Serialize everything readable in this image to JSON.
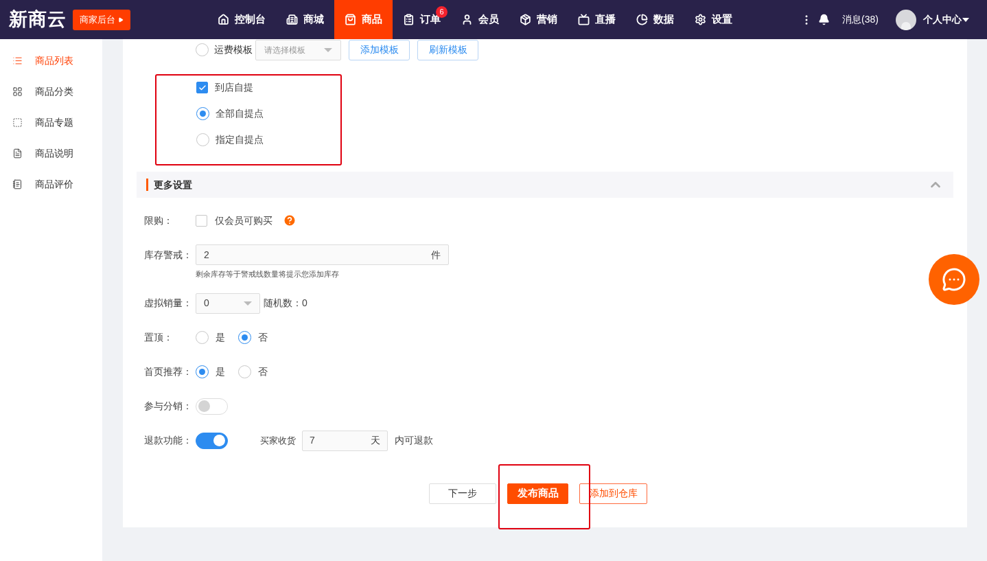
{
  "header": {
    "logo": "新商云",
    "merchant_button": "商家后台",
    "nav": [
      {
        "label": "控制台",
        "selected": false
      },
      {
        "label": "商城",
        "selected": false
      },
      {
        "label": "商品",
        "selected": true
      },
      {
        "label": "订单",
        "selected": false,
        "badge": "6"
      },
      {
        "label": "会员",
        "selected": false
      },
      {
        "label": "营销",
        "selected": false
      },
      {
        "label": "直播",
        "selected": false
      },
      {
        "label": "数据",
        "selected": false
      },
      {
        "label": "设置",
        "selected": false
      }
    ],
    "messages": "消息(38)",
    "user": "个人中心"
  },
  "sidebar": {
    "items": [
      {
        "label": "商品列表",
        "selected": true
      },
      {
        "label": "商品分类",
        "selected": false
      },
      {
        "label": "商品专题",
        "selected": false
      },
      {
        "label": "商品说明",
        "selected": false
      },
      {
        "label": "商品评价",
        "selected": false
      }
    ]
  },
  "shipping_row": {
    "label": "运费模板",
    "selected": false,
    "select_placeholder": "请选择模板",
    "buttons": [
      "添加模板",
      "刷新模板"
    ]
  },
  "pickup": {
    "checkbox": {
      "label": "到店自提",
      "checked": true
    },
    "options": [
      {
        "label": "全部自提点",
        "selected": true
      },
      {
        "label": "指定自提点",
        "selected": false
      }
    ]
  },
  "more_settings": {
    "title": "更多设置",
    "expanded": true,
    "fields": [
      {
        "kind": "checkbox",
        "label": "限购：",
        "option": "仅会员可购买",
        "checked": false
      },
      {
        "kind": "input",
        "label": "库存警戒：",
        "value": "2",
        "suffix": "件",
        "hint": "剩余库存等于警戒线数量将提示您添加库存"
      },
      {
        "kind": "select",
        "label": "虚拟销量：",
        "value": "0",
        "extra": "随机数：0"
      },
      {
        "kind": "radio",
        "label": "置顶：",
        "options": [
          {
            "label": "是",
            "selected": false
          },
          {
            "label": "否",
            "selected": true
          }
        ]
      },
      {
        "kind": "radio",
        "label": "首页推荐：",
        "options": [
          {
            "label": "是",
            "selected": true
          },
          {
            "label": "否",
            "selected": false
          }
        ]
      },
      {
        "kind": "toggle",
        "label": "参与分销：",
        "on": false
      },
      {
        "kind": "refund",
        "label": "退款功能：",
        "on": true,
        "prefix": "买家收货",
        "value": "7",
        "suffix": "天",
        "after": "内可退款"
      }
    ]
  },
  "actions": [
    {
      "label": "下一步",
      "kind": "default"
    },
    {
      "label": "发布商品",
      "kind": "primary"
    },
    {
      "label": "添加到仓库",
      "kind": "outline"
    }
  ]
}
